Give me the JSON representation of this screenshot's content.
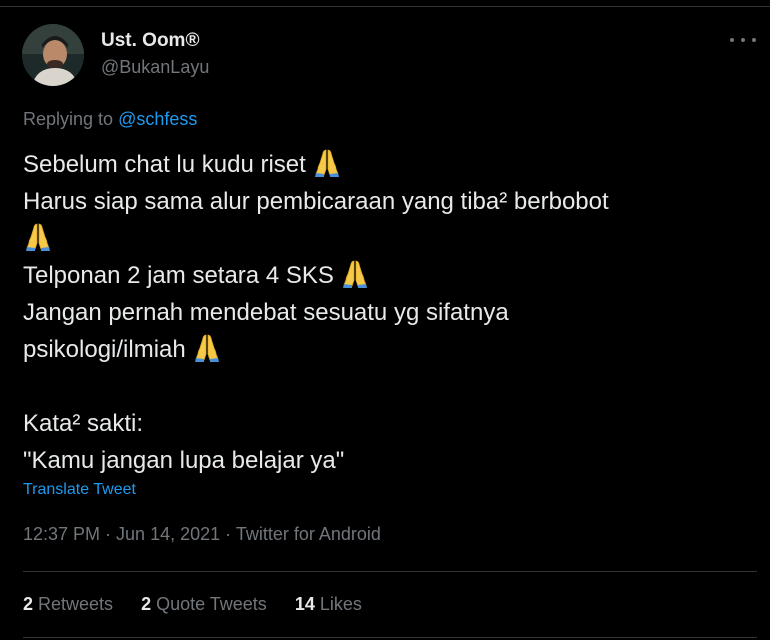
{
  "user": {
    "display_name": "Ust. Oom®",
    "handle": "@BukanLayu"
  },
  "reply": {
    "prefix": "Replying to ",
    "mention": "@schfess"
  },
  "tweet": {
    "lines": [
      "Sebelum chat lu kudu riset",
      "Harus siap sama alur pembicaraan yang tiba² berbobot",
      "Telponan 2 jam setara 4 SKS",
      "Jangan pernah mendebat sesuatu yg sifatnya",
      "psikologi/ilmiah",
      "Kata² sakti:",
      "\"Kamu jangan lupa belajar ya\""
    ],
    "emoji_icon": "folded-hands-icon"
  },
  "translate_label": "Translate Tweet",
  "meta": {
    "time": "12:37 PM",
    "separator": " · ",
    "date": "Jun 14, 2021",
    "source": "Twitter for Android"
  },
  "stats": {
    "retweets_count": "2",
    "retweets_label": "Retweets",
    "quotes_count": "2",
    "quotes_label": "Quote Tweets",
    "likes_count": "14",
    "likes_label": "Likes"
  },
  "colors": {
    "background": "#000000",
    "text": "#e7e9ea",
    "secondary": "#71767b",
    "link": "#1d9bf0",
    "divider": "#2f3336"
  }
}
